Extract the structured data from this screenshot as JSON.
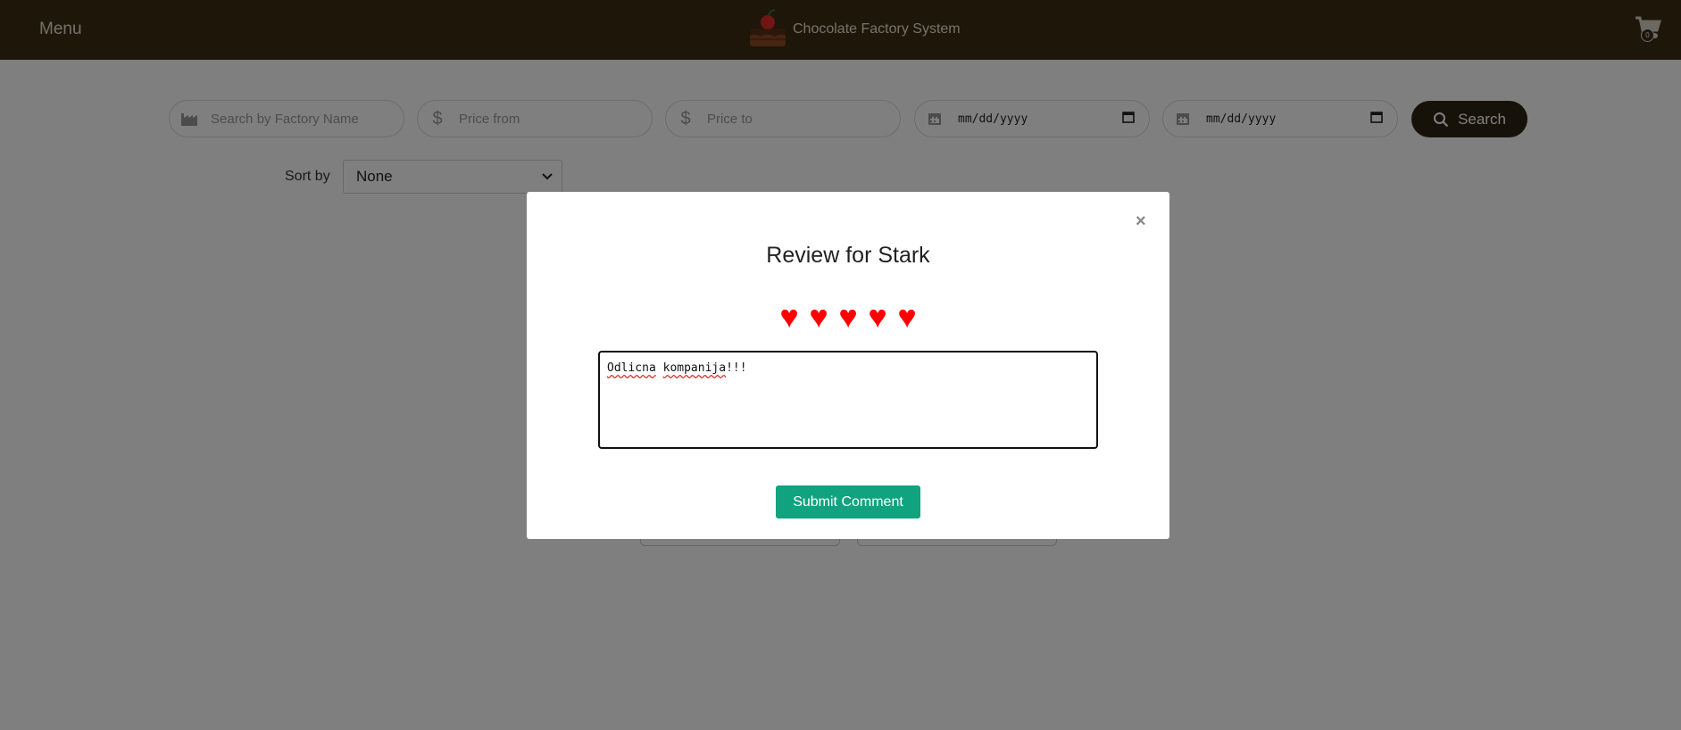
{
  "header": {
    "menu_label": "Menu",
    "brand_title": "Chocolate Factory System",
    "cart_count": "0"
  },
  "search": {
    "factory_placeholder": "Search by Factory Name",
    "price_from_placeholder": "Price from",
    "price_to_placeholder": "Price to",
    "date_from_value": "mm/dd/yyyy",
    "date_to_value": "mm/dd/yyyy",
    "search_label": "Search"
  },
  "sort": {
    "label": "Sort by",
    "selected": "None"
  },
  "modal": {
    "close_label": "×",
    "title": "Review for Stark",
    "rating": 5,
    "rating_max": 5,
    "heart_glyph": "♥",
    "comment_word1": "Odlicna",
    "comment_word2": "kompanija",
    "comment_tail": "!!!",
    "submit_label": "Submit Comment"
  },
  "colors": {
    "header_bg": "#3a2c12",
    "heart": "#ff0000",
    "submit_bg": "#11a37f"
  }
}
